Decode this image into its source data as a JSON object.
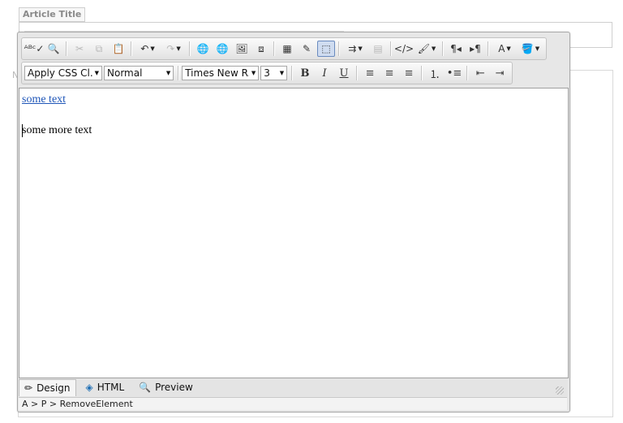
{
  "form": {
    "article_title_label": "Article Title",
    "side_letter": "N"
  },
  "editor": {
    "toolbar_row1": [
      {
        "name": "spellcheck-icon",
        "glyph": "ᴬᴮᶜ✓",
        "disabled": false
      },
      {
        "name": "find-icon",
        "glyph": "🔍",
        "disabled": false
      },
      {
        "sep": true
      },
      {
        "name": "cut-icon",
        "glyph": "✂",
        "disabled": true
      },
      {
        "name": "copy-icon",
        "glyph": "⧉",
        "disabled": true
      },
      {
        "name": "paste-icon",
        "glyph": "📋",
        "disabled": false
      },
      {
        "sep": true
      },
      {
        "name": "undo-icon",
        "glyph": "↶",
        "dd": true,
        "disabled": false
      },
      {
        "name": "redo-icon",
        "glyph": "↷",
        "dd": true,
        "disabled": true
      },
      {
        "sep": true
      },
      {
        "name": "hyperlink-icon",
        "glyph": "🌐",
        "disabled": false
      },
      {
        "name": "remove-link-icon",
        "glyph": "🌐",
        "disabled": true
      },
      {
        "name": "image-icon",
        "glyph": "🖼",
        "disabled": false
      },
      {
        "name": "media-icon",
        "glyph": "⧈",
        "disabled": false
      },
      {
        "sep": true
      },
      {
        "name": "table-icon",
        "glyph": "▦",
        "disabled": false
      },
      {
        "name": "table-properties-icon",
        "glyph": "✎",
        "disabled": false
      },
      {
        "name": "toggle-borders-icon",
        "glyph": "⬚",
        "active": true,
        "disabled": false
      },
      {
        "sep": true
      },
      {
        "name": "insert-row-icon",
        "glyph": "⇉",
        "dd": true,
        "disabled": false
      },
      {
        "name": "cell-properties-icon",
        "glyph": "▤",
        "disabled": true
      },
      {
        "sep": true
      },
      {
        "name": "html-snippet-icon",
        "glyph": "</>",
        "disabled": false
      },
      {
        "name": "format-stripper-icon",
        "glyph": "🖌",
        "dd": true,
        "disabled": false
      },
      {
        "sep": true
      },
      {
        "name": "ltr-icon",
        "glyph": "¶◂",
        "disabled": false
      },
      {
        "name": "rtl-icon",
        "glyph": "▸¶",
        "disabled": false
      },
      {
        "sep": true
      },
      {
        "name": "fore-color-icon",
        "glyph": "A",
        "dd": true,
        "disabled": false
      },
      {
        "name": "back-color-icon",
        "glyph": "🪣",
        "dd": true,
        "disabled": false
      }
    ],
    "css_class_select": "Apply CSS Cl...",
    "paragraph_select": "Normal",
    "font_name_select": "Times New R...",
    "font_size_select": "3",
    "format_buttons": [
      {
        "name": "bold-icon",
        "glyph": "B"
      },
      {
        "name": "italic-icon",
        "glyph": "I"
      },
      {
        "name": "underline-icon",
        "glyph": "U"
      },
      {
        "sep": true
      },
      {
        "name": "align-left-icon",
        "glyph": "≡"
      },
      {
        "name": "align-center-icon",
        "glyph": "≡"
      },
      {
        "name": "align-right-icon",
        "glyph": "≡"
      },
      {
        "sep": true
      },
      {
        "name": "numbered-list-icon",
        "glyph": "⒈"
      },
      {
        "name": "bulleted-list-icon",
        "glyph": "•≡"
      },
      {
        "sep": true
      },
      {
        "name": "outdent-icon",
        "glyph": "⇤"
      },
      {
        "name": "indent-icon",
        "glyph": "⇥"
      }
    ],
    "content": {
      "link_text": "some text",
      "paragraph_text": "some more text"
    },
    "modes": {
      "design": "Design",
      "html": "HTML",
      "preview": "Preview"
    },
    "status_path": "A > P > RemoveElement"
  }
}
